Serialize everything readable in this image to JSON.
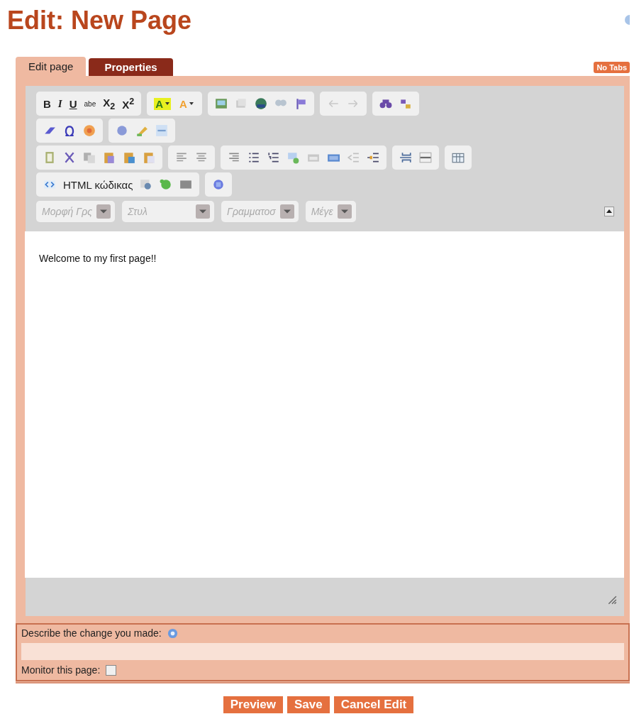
{
  "title": "Edit: New Page",
  "tabs": [
    {
      "label": "Edit page",
      "selected": true
    },
    {
      "label": "Properties",
      "selected": false
    }
  ],
  "no_tabs_button": "No Tabs",
  "toolbar": {
    "format_buttons": [
      "B",
      "I",
      "U",
      "abe",
      "X$_{2}$",
      "X$^{2}$"
    ],
    "color_buttons": [
      "A",
      "A"
    ],
    "source_button": "HTML κώδικας",
    "dropdowns": [
      "Μορφή Γρς",
      "Στυλ",
      "Γραμματοσ",
      "Μέγε"
    ]
  },
  "editor": {
    "content": "Welcome to my first page!!"
  },
  "summary": {
    "label": "Describe the change you made:"
  },
  "monitor": {
    "label": "Monitor this page:",
    "checked": false
  },
  "buttons": [
    "Preview",
    "Save",
    "Cancel Edit"
  ]
}
